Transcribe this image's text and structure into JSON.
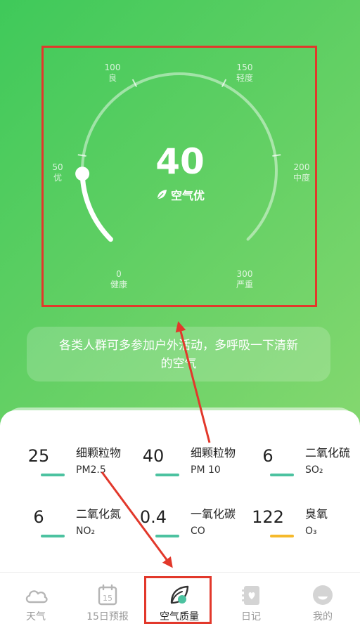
{
  "gauge": {
    "value": "40",
    "value_num": 40,
    "max": 300,
    "level": "空气优",
    "ticks": [
      {
        "num": "0",
        "label": "健康"
      },
      {
        "num": "50",
        "label": "优"
      },
      {
        "num": "100",
        "label": "良"
      },
      {
        "num": "150",
        "label": "轻度"
      },
      {
        "num": "200",
        "label": "中度"
      },
      {
        "num": "300",
        "label": "严重"
      }
    ]
  },
  "advice": "各类人群可多参加户外活动，多呼吸一下清新的空气",
  "pollutants": [
    {
      "value": "25",
      "name": "细颗粒物",
      "code": "PM2.5",
      "color": "#4cc2a0"
    },
    {
      "value": "40",
      "name": "细颗粒物",
      "code": "PM 10",
      "color": "#4cc2a0"
    },
    {
      "value": "6",
      "name": "二氧化硫",
      "code": "SO₂",
      "color": "#4cc2a0"
    },
    {
      "value": "6",
      "name": "二氧化氮",
      "code": "NO₂",
      "color": "#4cc2a0"
    },
    {
      "value": "0.4",
      "name": "一氧化碳",
      "code": "CO",
      "color": "#4cc2a0"
    },
    {
      "value": "122",
      "name": "臭氧",
      "code": "O₃",
      "color": "#f5b92b"
    }
  ],
  "tabs": [
    {
      "label": "天气",
      "icon": "cloud-icon"
    },
    {
      "label": "15日预报",
      "icon": "calendar-icon",
      "icon_text": "15"
    },
    {
      "label": "空气质量",
      "icon": "leaf-icon",
      "active": true
    },
    {
      "label": "日记",
      "icon": "diary-icon"
    },
    {
      "label": "我的",
      "icon": "profile-icon"
    }
  ],
  "colors": {
    "accent": "#4cc2a0",
    "warning": "#f5b92b",
    "highlight": "#e2382b"
  }
}
